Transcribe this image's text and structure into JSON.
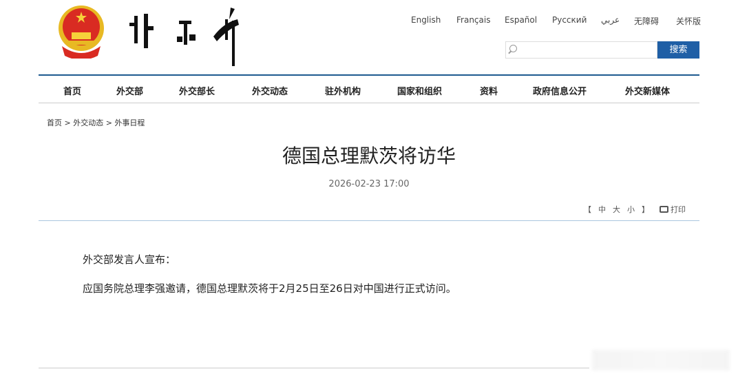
{
  "header": {
    "languages": [
      "English",
      "Français",
      "Español",
      "Русский",
      "عربي",
      "无障碍",
      "关怀版"
    ],
    "search": {
      "placeholder": "",
      "button": "搜索"
    }
  },
  "nav": [
    "首页",
    "外交部",
    "外交部长",
    "外交动态",
    "驻外机构",
    "国家和组织",
    "资料",
    "政府信息公开",
    "外交新媒体"
  ],
  "breadcrumb": [
    "首页",
    "外交动态",
    "外事日程"
  ],
  "article": {
    "title": "德国总理默茨将访华",
    "date": "2026-02-23 17:00",
    "font_sizes": {
      "open": "【",
      "mid": "中",
      "large": "大",
      "small": "小",
      "close": "】"
    },
    "print": "打印",
    "paragraphs": [
      "外交部发言人宣布：",
      "应国务院总理李强邀请，德国总理默茨将于2月25日至26日对中国进行正式访问。"
    ]
  },
  "colors": {
    "accent": "#1f5fa6",
    "nav_line": "#1d5a8f"
  }
}
